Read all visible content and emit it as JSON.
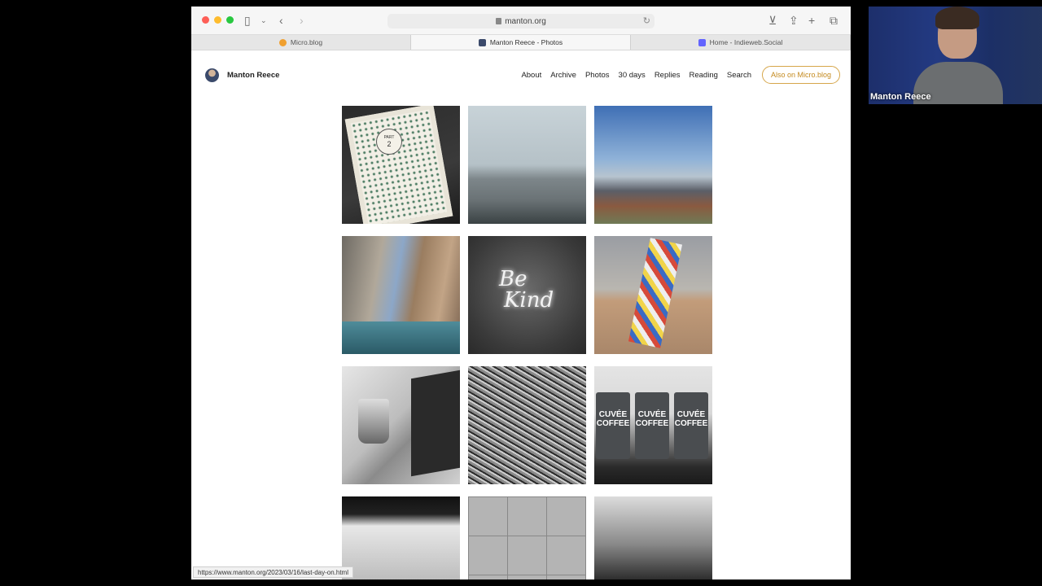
{
  "browser": {
    "address": "manton.org",
    "tabs": [
      {
        "label": "Micro.blog",
        "favicon_color": "#f0a030"
      },
      {
        "label": "Manton Reece - Photos",
        "favicon_color": "#3b4a6b"
      },
      {
        "label": "Home - Indieweb.Social",
        "favicon_color": "#6364ff"
      }
    ],
    "status_url": "https://www.manton.org/2023/03/16/last-day-on.html"
  },
  "site": {
    "name": "Manton Reece",
    "nav": [
      "About",
      "Archive",
      "Photos",
      "30 days",
      "Replies",
      "Reading",
      "Search"
    ],
    "button": "Also on Micro.blog",
    "accent": "#d6a64a"
  },
  "photos": {
    "book_label_top": "PART",
    "book_label_number": "2",
    "neon_line1": "Be",
    "neon_line2": "Kind",
    "bag_text": "CUVÉE COFFEE"
  },
  "webcam": {
    "name": "Manton Reece"
  }
}
